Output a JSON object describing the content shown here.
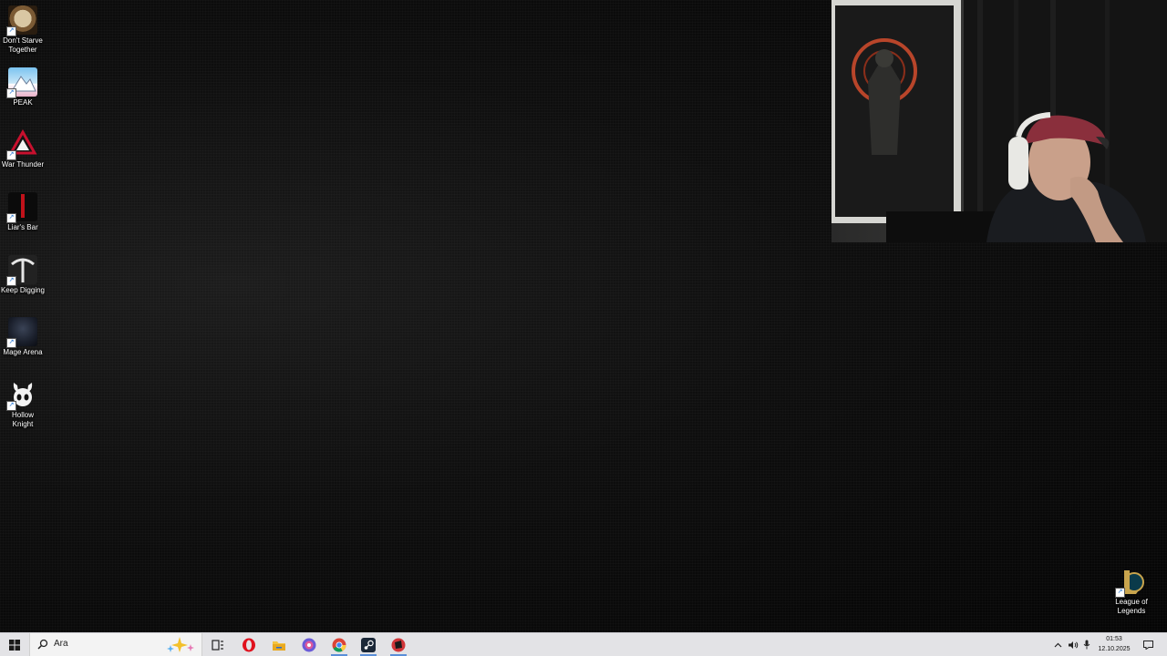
{
  "desktop": {
    "icons": [
      {
        "label_line1": "Don't Starve",
        "label_line2": "Together",
        "icon": "dont-starve-together-icon"
      },
      {
        "label_line1": "PEAK",
        "label_line2": "",
        "icon": "peak-icon"
      },
      {
        "label_line1": "War Thunder",
        "label_line2": "",
        "icon": "war-thunder-icon"
      },
      {
        "label_line1": "Liar's Bar",
        "label_line2": "",
        "icon": "liars-bar-icon"
      },
      {
        "label_line1": "Keep Digging",
        "label_line2": "",
        "icon": "keep-digging-icon"
      },
      {
        "label_line1": "Mage Arena",
        "label_line2": "",
        "icon": "mage-arena-icon"
      },
      {
        "label_line1": "Hollow",
        "label_line2": "Knight",
        "icon": "hollow-knight-icon"
      },
      {
        "label_line1": "League of",
        "label_line2": "Legends",
        "icon": "league-of-legends-icon"
      }
    ]
  },
  "taskbar": {
    "search": {
      "placeholder": "Ara"
    },
    "pinned": [
      {
        "name": "task-view",
        "icon": "task-view-icon"
      },
      {
        "name": "opera",
        "icon": "opera-icon"
      },
      {
        "name": "file-explorer",
        "icon": "folder-icon"
      },
      {
        "name": "discord-like",
        "icon": "chat-app-icon"
      },
      {
        "name": "chrome",
        "icon": "chrome-icon"
      },
      {
        "name": "steam",
        "icon": "steam-icon"
      },
      {
        "name": "riot-client",
        "icon": "riot-icon"
      }
    ],
    "clock": {
      "time": "01:53",
      "date": "12.10.2025"
    },
    "colors": {
      "background": "#e3e3e6",
      "accent": "#0078d4"
    }
  }
}
